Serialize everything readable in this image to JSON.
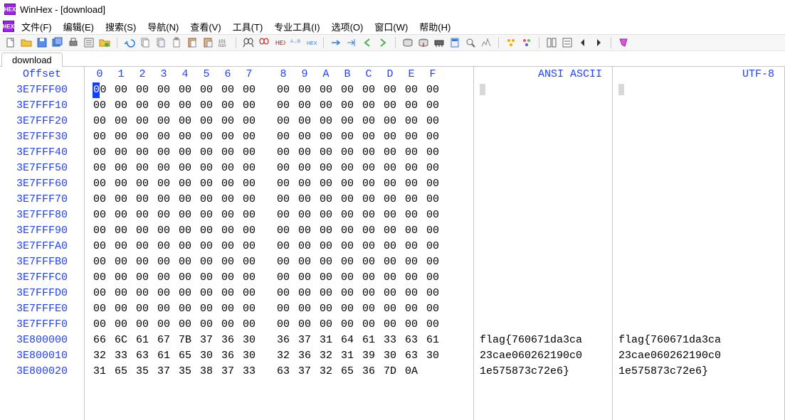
{
  "title": "WinHex - [download]",
  "menu": [
    "文件(F)",
    "编辑(E)",
    "搜索(S)",
    "导航(N)",
    "查看(V)",
    "工具(T)",
    "专业工具(I)",
    "选项(O)",
    "窗口(W)",
    "帮助(H)"
  ],
  "tab": "download",
  "headers": {
    "offset": "Offset",
    "hex": [
      "0",
      "1",
      "2",
      "3",
      "4",
      "5",
      "6",
      "7",
      "8",
      "9",
      "A",
      "B",
      "C",
      "D",
      "E",
      "F"
    ],
    "ansi": "ANSI ASCII",
    "utf8": "UTF-8"
  },
  "rows": [
    {
      "o": "3E7FFF00",
      "h": [
        "00",
        "00",
        "00",
        "00",
        "00",
        "00",
        "00",
        "00",
        "00",
        "00",
        "00",
        "00",
        "00",
        "00",
        "00",
        "00"
      ],
      "a": "",
      "u": ""
    },
    {
      "o": "3E7FFF10",
      "h": [
        "00",
        "00",
        "00",
        "00",
        "00",
        "00",
        "00",
        "00",
        "00",
        "00",
        "00",
        "00",
        "00",
        "00",
        "00",
        "00"
      ],
      "a": "",
      "u": ""
    },
    {
      "o": "3E7FFF20",
      "h": [
        "00",
        "00",
        "00",
        "00",
        "00",
        "00",
        "00",
        "00",
        "00",
        "00",
        "00",
        "00",
        "00",
        "00",
        "00",
        "00"
      ],
      "a": "",
      "u": ""
    },
    {
      "o": "3E7FFF30",
      "h": [
        "00",
        "00",
        "00",
        "00",
        "00",
        "00",
        "00",
        "00",
        "00",
        "00",
        "00",
        "00",
        "00",
        "00",
        "00",
        "00"
      ],
      "a": "",
      "u": ""
    },
    {
      "o": "3E7FFF40",
      "h": [
        "00",
        "00",
        "00",
        "00",
        "00",
        "00",
        "00",
        "00",
        "00",
        "00",
        "00",
        "00",
        "00",
        "00",
        "00",
        "00"
      ],
      "a": "",
      "u": ""
    },
    {
      "o": "3E7FFF50",
      "h": [
        "00",
        "00",
        "00",
        "00",
        "00",
        "00",
        "00",
        "00",
        "00",
        "00",
        "00",
        "00",
        "00",
        "00",
        "00",
        "00"
      ],
      "a": "",
      "u": ""
    },
    {
      "o": "3E7FFF60",
      "h": [
        "00",
        "00",
        "00",
        "00",
        "00",
        "00",
        "00",
        "00",
        "00",
        "00",
        "00",
        "00",
        "00",
        "00",
        "00",
        "00"
      ],
      "a": "",
      "u": ""
    },
    {
      "o": "3E7FFF70",
      "h": [
        "00",
        "00",
        "00",
        "00",
        "00",
        "00",
        "00",
        "00",
        "00",
        "00",
        "00",
        "00",
        "00",
        "00",
        "00",
        "00"
      ],
      "a": "",
      "u": ""
    },
    {
      "o": "3E7FFF80",
      "h": [
        "00",
        "00",
        "00",
        "00",
        "00",
        "00",
        "00",
        "00",
        "00",
        "00",
        "00",
        "00",
        "00",
        "00",
        "00",
        "00"
      ],
      "a": "",
      "u": ""
    },
    {
      "o": "3E7FFF90",
      "h": [
        "00",
        "00",
        "00",
        "00",
        "00",
        "00",
        "00",
        "00",
        "00",
        "00",
        "00",
        "00",
        "00",
        "00",
        "00",
        "00"
      ],
      "a": "",
      "u": ""
    },
    {
      "o": "3E7FFFA0",
      "h": [
        "00",
        "00",
        "00",
        "00",
        "00",
        "00",
        "00",
        "00",
        "00",
        "00",
        "00",
        "00",
        "00",
        "00",
        "00",
        "00"
      ],
      "a": "",
      "u": ""
    },
    {
      "o": "3E7FFFB0",
      "h": [
        "00",
        "00",
        "00",
        "00",
        "00",
        "00",
        "00",
        "00",
        "00",
        "00",
        "00",
        "00",
        "00",
        "00",
        "00",
        "00"
      ],
      "a": "",
      "u": ""
    },
    {
      "o": "3E7FFFC0",
      "h": [
        "00",
        "00",
        "00",
        "00",
        "00",
        "00",
        "00",
        "00",
        "00",
        "00",
        "00",
        "00",
        "00",
        "00",
        "00",
        "00"
      ],
      "a": "",
      "u": ""
    },
    {
      "o": "3E7FFFD0",
      "h": [
        "00",
        "00",
        "00",
        "00",
        "00",
        "00",
        "00",
        "00",
        "00",
        "00",
        "00",
        "00",
        "00",
        "00",
        "00",
        "00"
      ],
      "a": "",
      "u": ""
    },
    {
      "o": "3E7FFFE0",
      "h": [
        "00",
        "00",
        "00",
        "00",
        "00",
        "00",
        "00",
        "00",
        "00",
        "00",
        "00",
        "00",
        "00",
        "00",
        "00",
        "00"
      ],
      "a": "",
      "u": ""
    },
    {
      "o": "3E7FFFF0",
      "h": [
        "00",
        "00",
        "00",
        "00",
        "00",
        "00",
        "00",
        "00",
        "00",
        "00",
        "00",
        "00",
        "00",
        "00",
        "00",
        "00"
      ],
      "a": "",
      "u": ""
    },
    {
      "o": "3E800000",
      "h": [
        "66",
        "6C",
        "61",
        "67",
        "7B",
        "37",
        "36",
        "30",
        "36",
        "37",
        "31",
        "64",
        "61",
        "33",
        "63",
        "61"
      ],
      "a": "flag{760671da3ca",
      "u": "flag{760671da3ca"
    },
    {
      "o": "3E800010",
      "h": [
        "32",
        "33",
        "63",
        "61",
        "65",
        "30",
        "36",
        "30",
        "32",
        "36",
        "32",
        "31",
        "39",
        "30",
        "63",
        "30"
      ],
      "a": "23cae060262190c0",
      "u": "23cae060262190c0"
    },
    {
      "o": "3E800020",
      "h": [
        "31",
        "65",
        "35",
        "37",
        "35",
        "38",
        "37",
        "33",
        "63",
        "37",
        "32",
        "65",
        "36",
        "7D",
        "0A",
        ""
      ],
      "a": "1e575873c72e6}",
      "u": "1e575873c72e6}"
    }
  ],
  "caret": {
    "row": 0,
    "col": 0
  }
}
